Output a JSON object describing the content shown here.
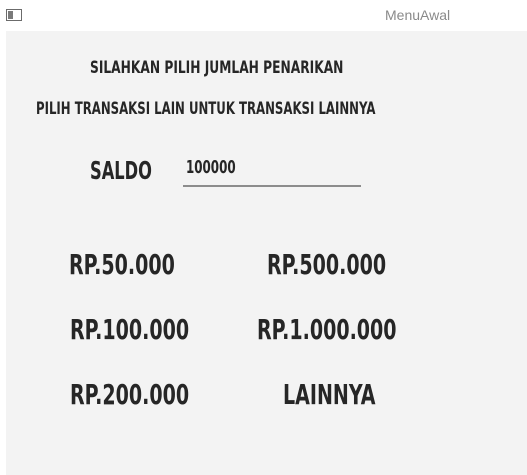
{
  "window": {
    "title": "MenuAwal"
  },
  "instructions": {
    "line1": "SILAHKAN PILIH JUMLAH PENARIKAN",
    "line2": "PILIH TRANSAKSI LAIN UNTUK TRANSAKSI LAINNYA"
  },
  "saldo": {
    "label": "SALDO",
    "value": "100000"
  },
  "buttons": {
    "rp_50000": "RP.50.000",
    "rp_500000": "RP.500.000",
    "rp_100000": "RP.100.000",
    "rp_1000000": "RP.1.000.000",
    "rp_200000": "RP.200.000",
    "lainnya": "LAINNYA"
  }
}
